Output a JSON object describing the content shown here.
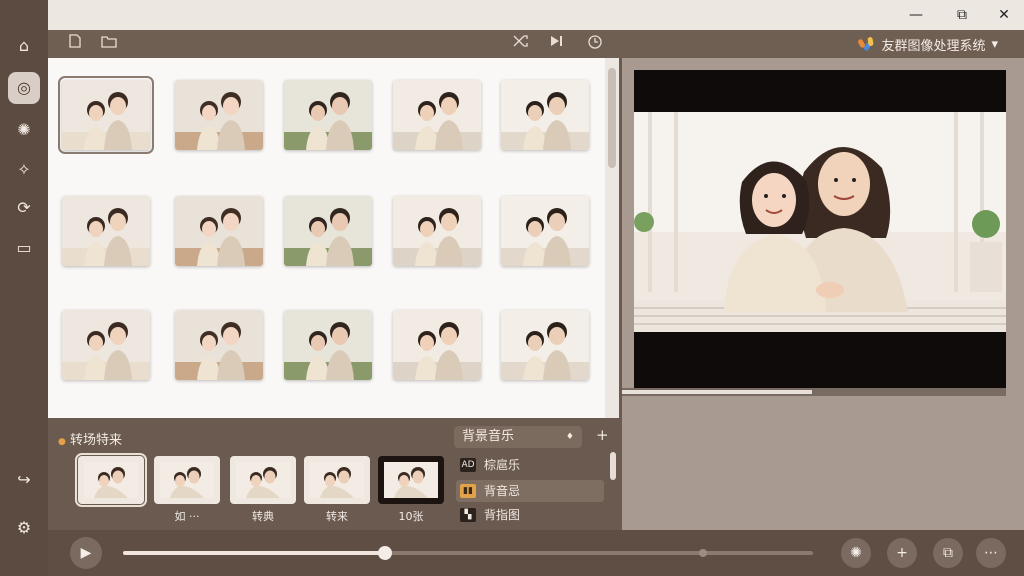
{
  "app": {
    "title": "友群图像处理系统",
    "title_chevron": "▾"
  },
  "window": {
    "minimize": "—",
    "maximize": "⧉",
    "close": "✕"
  },
  "toolbar": {
    "left_icons": [
      "file-icon",
      "folder-icon"
    ],
    "right_icons": [
      "shuffle-icon",
      "skip-icon",
      "timer-icon"
    ]
  },
  "sidebar": {
    "items": [
      {
        "name": "home-icon",
        "glyph": "⌂"
      },
      {
        "name": "target-icon",
        "glyph": "◎"
      },
      {
        "name": "effects-icon",
        "glyph": "✺"
      },
      {
        "name": "magic-icon",
        "glyph": "✧"
      },
      {
        "name": "tools-icon",
        "glyph": "⟳"
      },
      {
        "name": "display-icon",
        "glyph": "▭"
      },
      {
        "name": "share-icon",
        "glyph": "↪"
      },
      {
        "name": "settings-icon",
        "glyph": "⚙"
      }
    ]
  },
  "gallery": {
    "count": 15,
    "selected_index": 0
  },
  "transitions": {
    "title": "转场特来",
    "items": [
      {
        "label": ""
      },
      {
        "label": "如 ···"
      },
      {
        "label": "转典"
      },
      {
        "label": "转来"
      },
      {
        "label": "10张"
      }
    ]
  },
  "music": {
    "title": "背景音乐",
    "add": "+",
    "dropdown": "♦",
    "items": [
      {
        "label": "棕扈乐",
        "icon": "AD"
      },
      {
        "label": "背音忌",
        "icon": "▮▮"
      },
      {
        "label": "背指图",
        "icon": "▚"
      }
    ]
  },
  "transport": {
    "play": "▶",
    "progress": 0.38,
    "marker": 0.84,
    "buttons": [
      "effects-button",
      "add-button",
      "export-button",
      "more-button"
    ],
    "button_glyphs": [
      "✺",
      "+",
      "⧉",
      "⋯"
    ]
  },
  "colors": {
    "accent": "#8a7a70",
    "background": "#6b5a4e",
    "gallery_bg": "#faf8f6"
  }
}
